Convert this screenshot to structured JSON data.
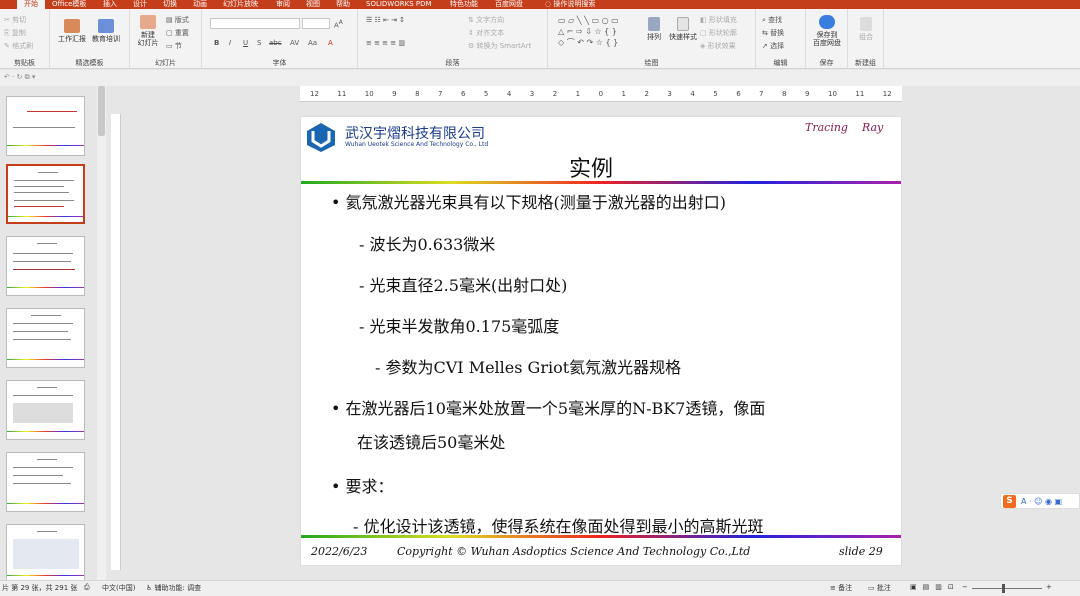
{
  "tabs": [
    "开始",
    "Office模板",
    "插入",
    "设计",
    "切换",
    "动画",
    "幻灯片放映",
    "审阅",
    "视图",
    "帮助",
    "SOLIDWORKS PDM",
    "特色功能",
    "百度网盘",
    "操作说明搜索"
  ],
  "clipboard": {
    "cut": "剪切",
    "copy": "复制",
    "painter": "格式刷",
    "label": "剪贴板"
  },
  "templates": {
    "report": "工作汇报",
    "training": "教育培训",
    "label": "精选模板"
  },
  "slides": {
    "new": "新建\n幻灯片",
    "layout": "版式",
    "reset": "重置",
    "section": "节",
    "label": "幻灯片"
  },
  "font": {
    "label": "字体",
    "bold": "B",
    "italic": "I",
    "underline": "U",
    "shadow": "S",
    "strike": "abc",
    "spacing": "AV",
    "case": "Aa"
  },
  "paragraph": {
    "text_dir": "文字方向",
    "align_text": "对齐文本",
    "smartart": "转换为 SmartArt",
    "label": "段落"
  },
  "drawing": {
    "arrange": "排列",
    "quick_styles": "快速样式",
    "fill": "形状填充",
    "outline": "形状轮廓",
    "effect": "形状效果",
    "label": "绘图"
  },
  "editing": {
    "find": "查找",
    "replace": "替换",
    "select": "选择",
    "label": "编辑"
  },
  "save": {
    "button": "保存到\n百度网盘",
    "label": "保存"
  },
  "newgroup": {
    "button": "组合",
    "label": "新建组"
  },
  "ruler_marks": [
    "12",
    "11",
    "10",
    "9",
    "8",
    "7",
    "6",
    "5",
    "4",
    "3",
    "2",
    "1",
    "0",
    "1",
    "2",
    "3",
    "4",
    "5",
    "6",
    "7",
    "8",
    "9",
    "10",
    "11",
    "12"
  ],
  "slide": {
    "company_cn": "武汉宇熠科技有限公司",
    "company_en": "Wuhan Ueotek Science And Technology Co., Ltd",
    "brand": "Tracing    Ray",
    "title": "实例",
    "lines": [
      "•  氦氖激光器光束具有以下规格(测量于激光器的出射口)",
      "- 波长为0.633微米",
      "- 光束直径2.5毫米(出射口处)",
      "- 光束半发散角0.175毫弧度",
      "- 参数为CVI Melles Griot氦氖激光器规格",
      "•  在激光器后10毫米处放置一个5毫米厚的N-BK7透镜，像面",
      "在该透镜后50毫米处",
      "•  要求：",
      "- 优化设计该透镜，使得系统在像面处得到最小的高斯光斑"
    ],
    "footer_date": "2022/6/23",
    "footer_copy": "Copyright © Wuhan Asdoptics Science And Technology Co.,Ltd",
    "footer_slide": "slide 29"
  },
  "status": {
    "slide_count": "片 第 29 张，共 291 张",
    "lang": "中文(中国)",
    "access": "辅助功能: 调查",
    "notes": "备注",
    "comments": "批注"
  },
  "sogou": {
    "logo": "S",
    "items": "A · ☺ ◉ ▣"
  }
}
